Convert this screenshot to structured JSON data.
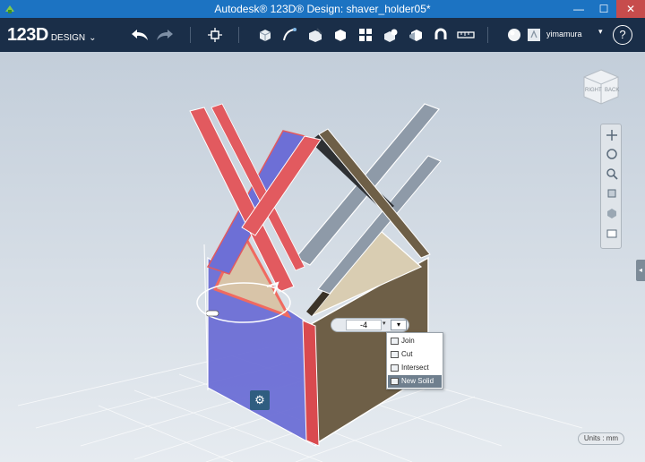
{
  "window": {
    "title": "Autodesk® 123D® Design: shaver_holder05*",
    "minimize_glyph": "—",
    "maximize_glyph": "☐",
    "close_glyph": "✕"
  },
  "brand": {
    "name": "123D",
    "suffix": "DESIGN",
    "chevron": "⌄"
  },
  "toolbar": {
    "tools": [
      "undo-icon",
      "redo-icon",
      "transform-icon",
      "primitives-icon",
      "sketch-icon",
      "construct-icon",
      "modify-icon",
      "pattern-icon",
      "grouping-icon",
      "combine-icon",
      "snap-icon",
      "measure-icon",
      "material-icon",
      "text-icon"
    ],
    "user_name": "yimamura",
    "user_caret": "▾",
    "help_label": "?"
  },
  "viewcube": {
    "right_label": "RIGHT",
    "back_label": "BACK"
  },
  "value_widget": {
    "value": "-4",
    "caret": "▾",
    "op_glyph": "▾"
  },
  "combine_menu": {
    "items": [
      {
        "label": "Join",
        "selected": false
      },
      {
        "label": "Cut",
        "selected": false
      },
      {
        "label": "Intersect",
        "selected": false
      },
      {
        "label": "New Solid",
        "selected": true
      }
    ]
  },
  "gear": {
    "glyph": "⚙"
  },
  "side_tab": {
    "glyph": "◂"
  },
  "status": {
    "units_label": "Units : mm"
  },
  "colors": {
    "titlebar": "#1c73c2",
    "toolbar": "#1a2e48",
    "viewport": "#c9d3dc",
    "selected_blue": "#6d6fd6",
    "highlight_red": "#e25a5f",
    "solid_brown": "#6e5f47",
    "solid_gray": "#8e9aa8",
    "triangle_fill": "#d9cdb2"
  }
}
